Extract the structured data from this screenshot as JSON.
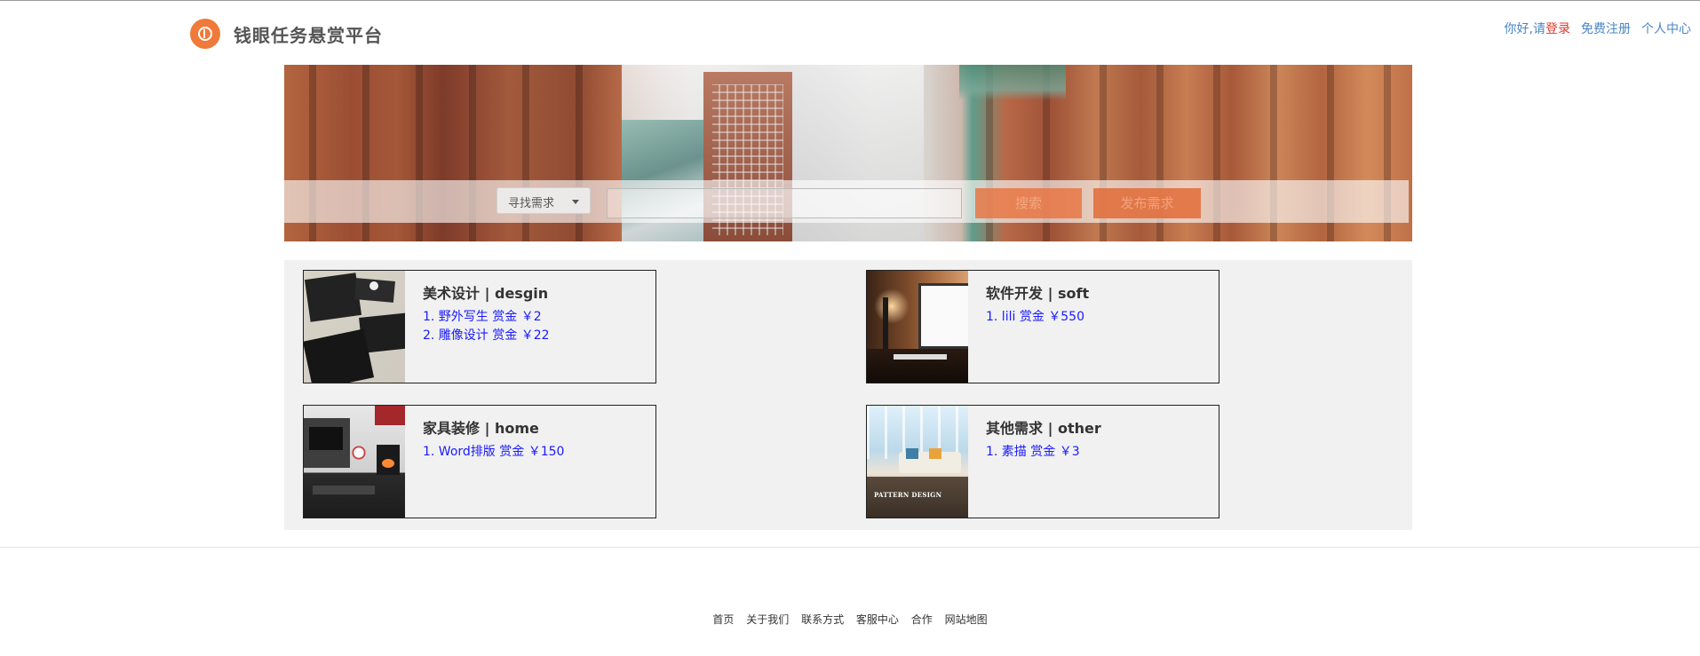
{
  "header": {
    "site_title": "钱眼任务悬赏平台",
    "logo_icon": "logo-icon",
    "greeting": "你好,请",
    "login": "登录",
    "register": "免费注册",
    "user_center": "个人中心"
  },
  "banner": {
    "search_type": "寻找需求",
    "search_placeholder": "",
    "search_button": "搜索",
    "post_button": "发布需求"
  },
  "categories": [
    {
      "title": "美术设计 | desgin",
      "items": [
        "1.   野外写生 赏金 ￥2",
        "2.   雕像设计 赏金 ￥22"
      ]
    },
    {
      "title": "软件开发 | soft",
      "items": [
        "1.   lili 赏金 ￥550"
      ]
    },
    {
      "title": "家具装修 | home",
      "items": [
        "1.   Word排版 赏金 ￥150"
      ]
    },
    {
      "title": "其他需求 | other",
      "items": [
        "1.   素描 赏金 ￥3"
      ]
    }
  ],
  "thumb_caption": "PATTERN DESIGN",
  "footer": {
    "links": [
      "首页",
      "关于我们",
      "联系方式",
      "客服中心",
      "合作",
      "网站地图"
    ]
  },
  "colors": {
    "accent": "#e8703a",
    "link_blue": "#4a86c5",
    "item_blue": "#1a1aff",
    "login_red": "#e0392b"
  }
}
